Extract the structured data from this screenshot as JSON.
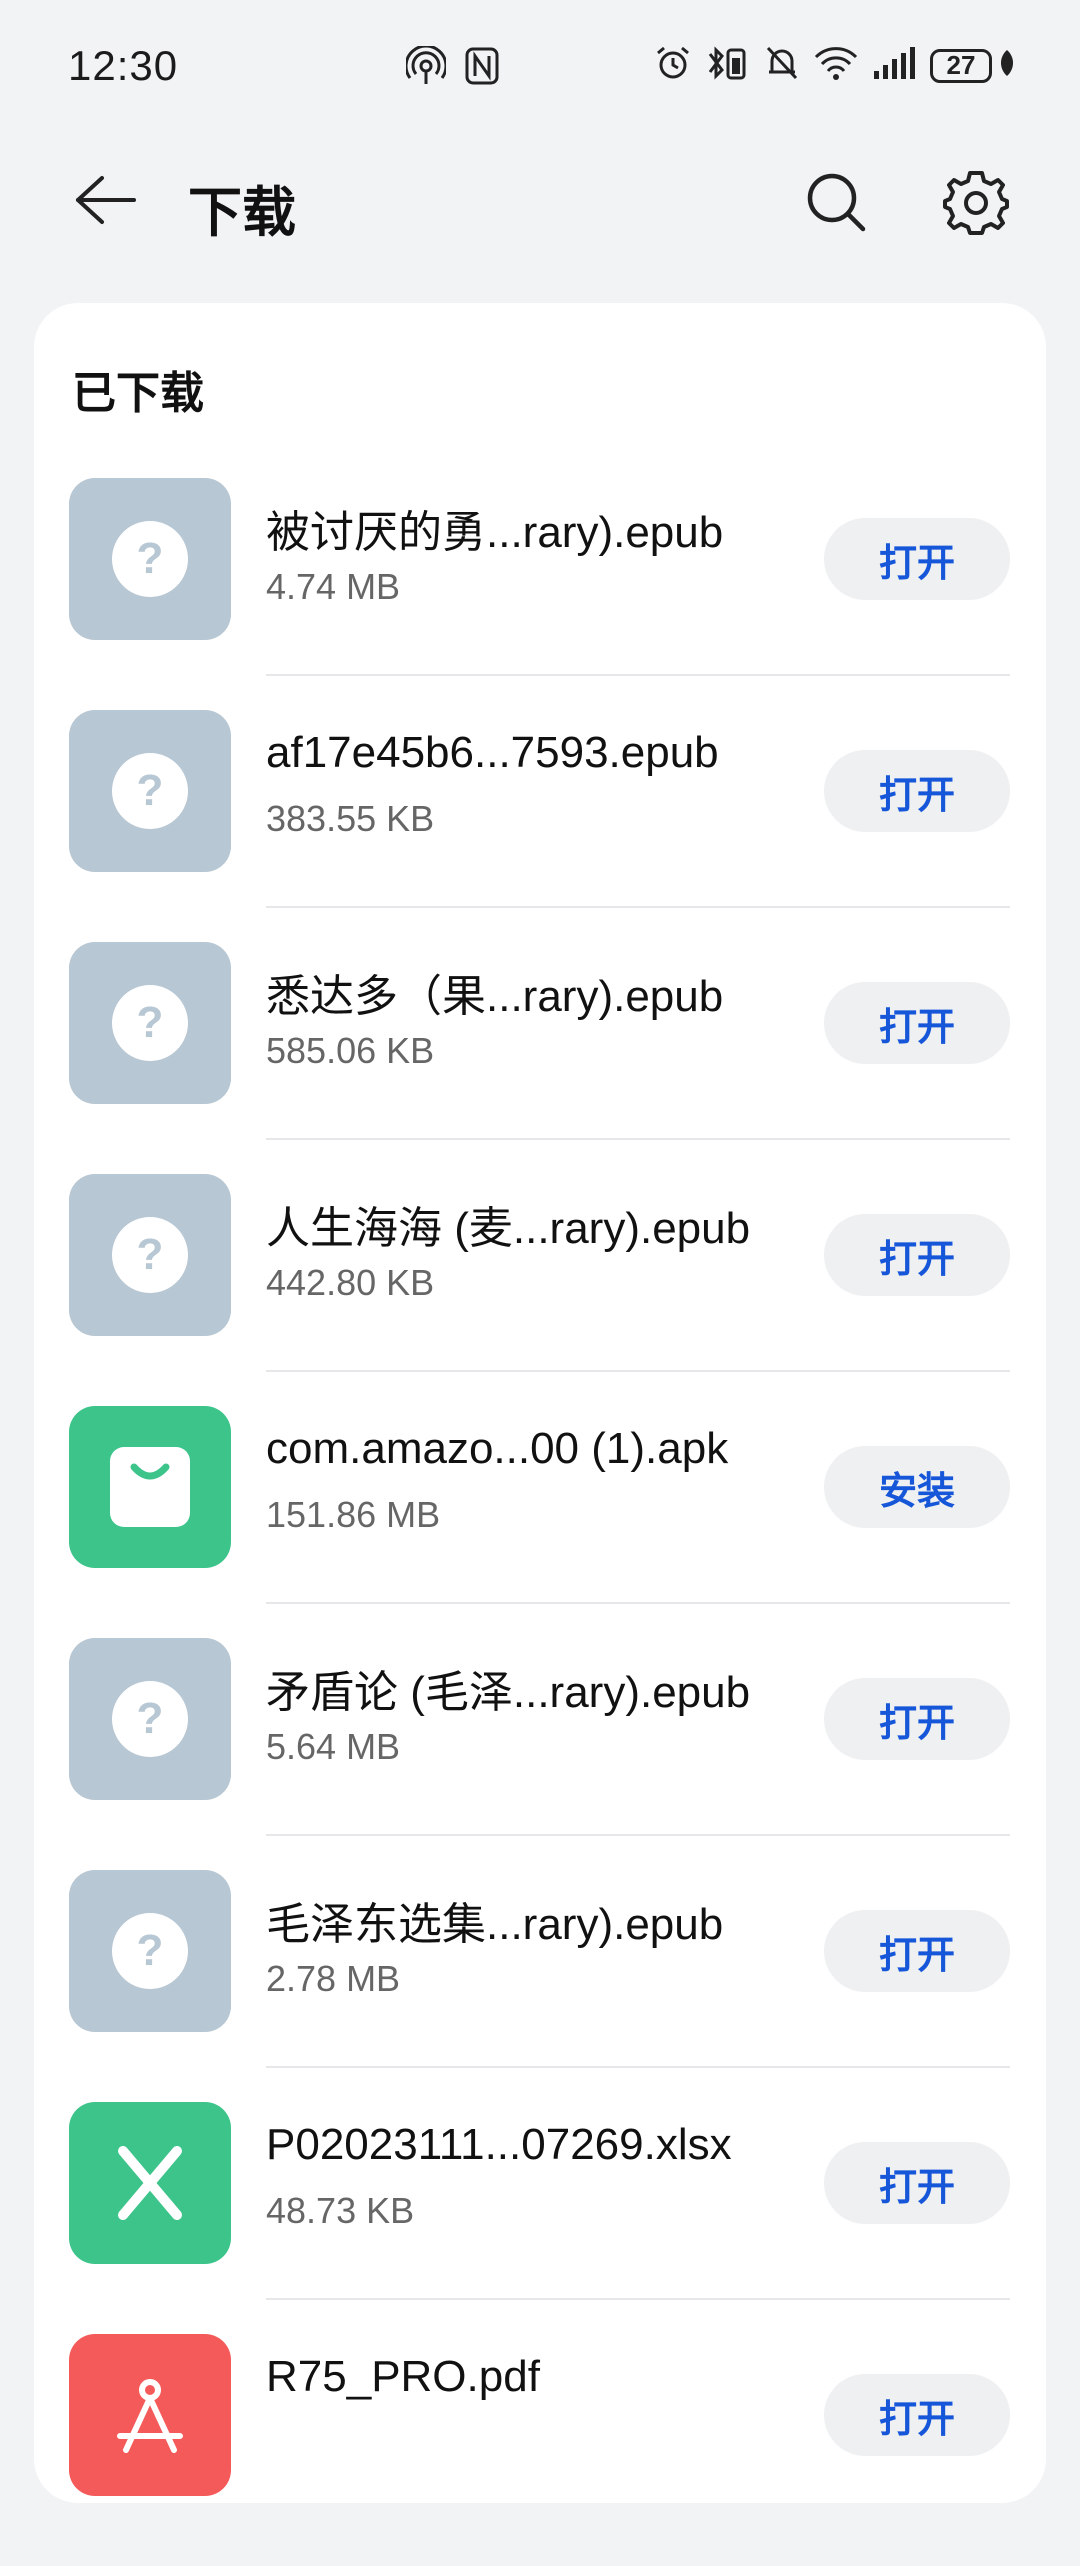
{
  "status_bar": {
    "time": "12:30",
    "battery": "27"
  },
  "header": {
    "title": "下载"
  },
  "section": {
    "title": "已下载"
  },
  "colors": {
    "unknown_icon_bg": "#b7c7d3",
    "green_icon_bg": "#3cc48a",
    "red_icon_bg": "#f55a5a",
    "button_text": "#1656d8",
    "button_bg": "#eef0f2"
  },
  "files": [
    {
      "name": "被讨厌的勇...rary).epub",
      "size": "4.74 MB",
      "action": "打开",
      "icon": "unknown-file-icon"
    },
    {
      "name": "af17e45b6...7593.epub",
      "size": "383.55 KB",
      "action": "打开",
      "icon": "unknown-file-icon"
    },
    {
      "name": "悉达多（果...rary).epub",
      "size": "585.06 KB",
      "action": "打开",
      "icon": "unknown-file-icon"
    },
    {
      "name": "人生海海 (麦...rary).epub",
      "size": "442.80 KB",
      "action": "打开",
      "icon": "unknown-file-icon"
    },
    {
      "name": "com.amazo...00 (1).apk",
      "size": "151.86 MB",
      "action": "安装",
      "icon": "apk-bag-icon"
    },
    {
      "name": "矛盾论 (毛泽...rary).epub",
      "size": "5.64 MB",
      "action": "打开",
      "icon": "unknown-file-icon"
    },
    {
      "name": "毛泽东选集...rary).epub",
      "size": "2.78 MB",
      "action": "打开",
      "icon": "unknown-file-icon"
    },
    {
      "name": "P02023111...07269.xlsx",
      "size": "48.73 KB",
      "action": "打开",
      "icon": "excel-x-icon"
    },
    {
      "name": "R75_PRO.pdf",
      "size": "",
      "action": "打开",
      "icon": "pdf-icon"
    }
  ]
}
